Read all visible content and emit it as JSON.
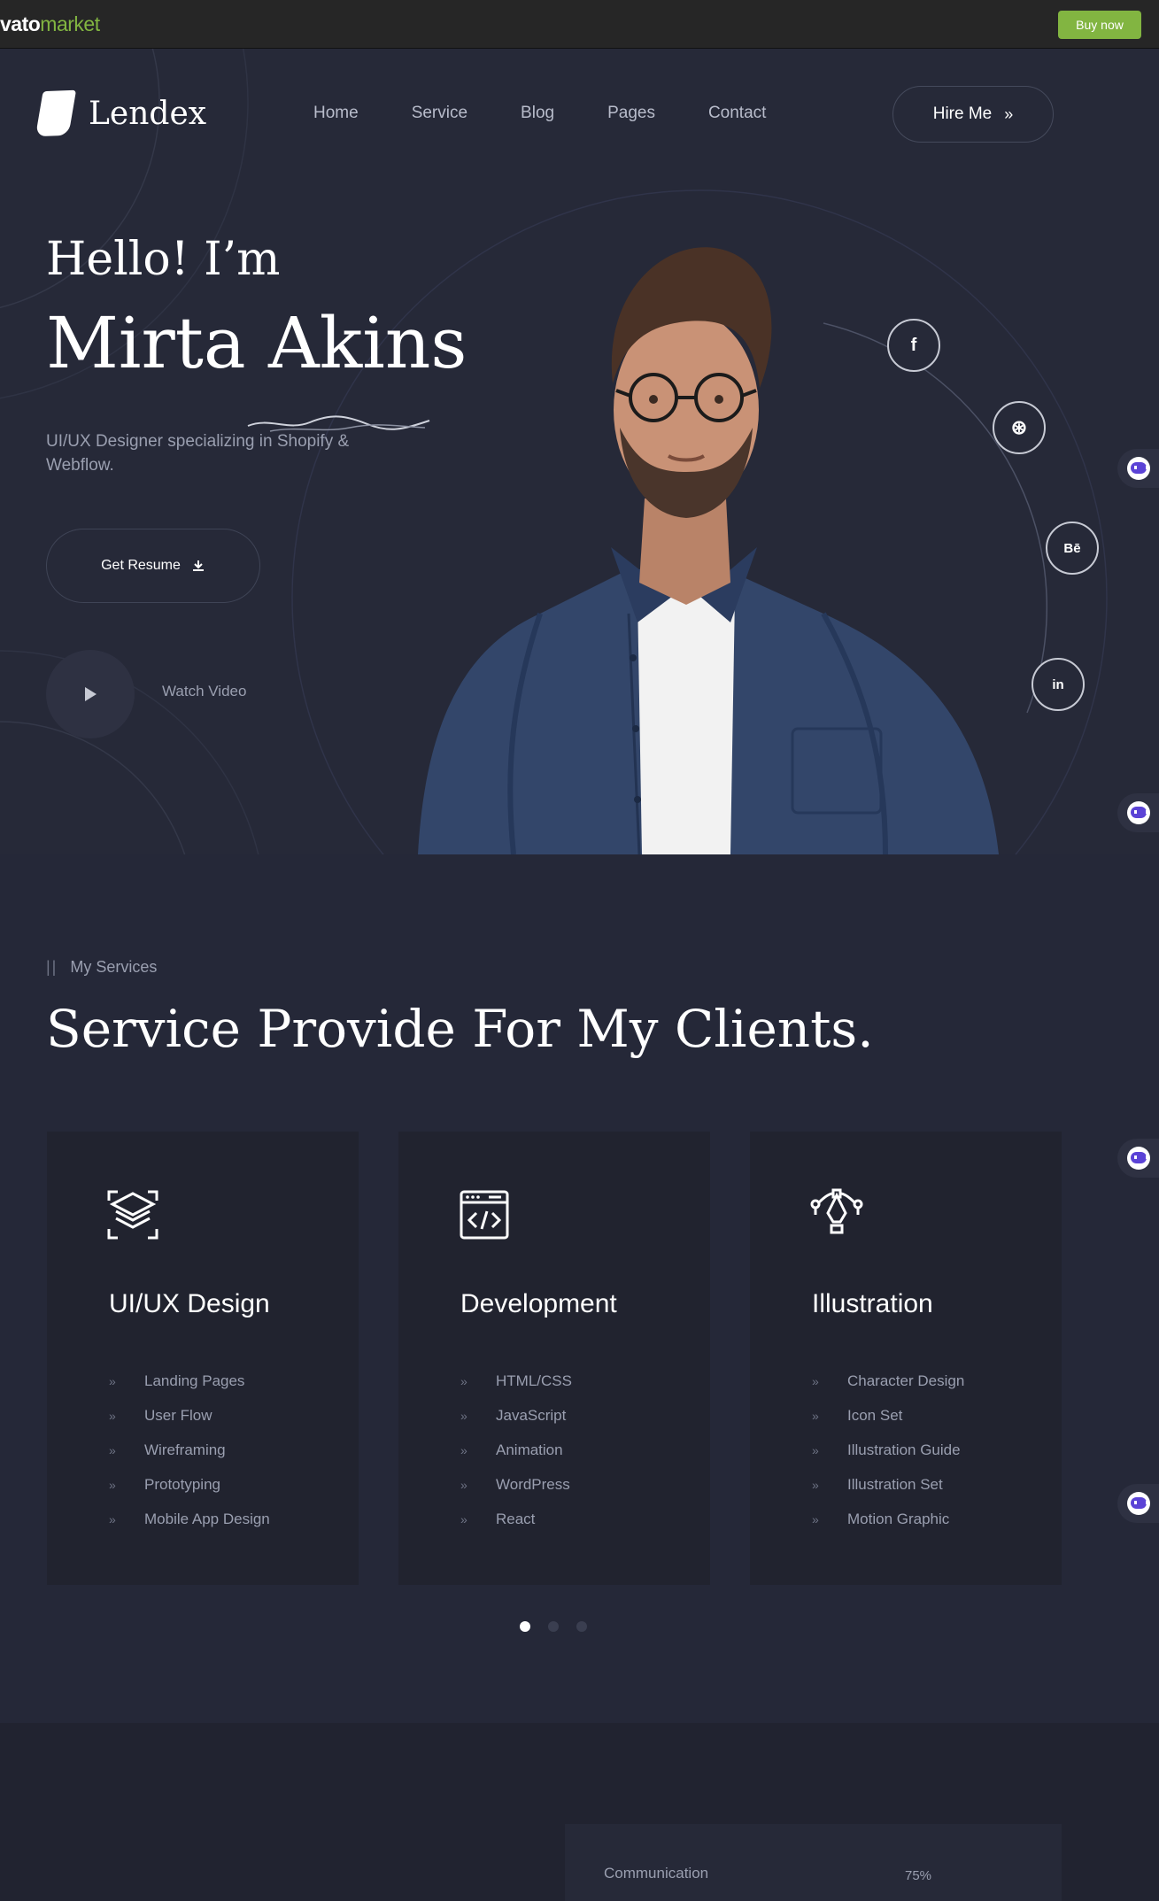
{
  "envato": {
    "logo_part1": "vato",
    "logo_part2": "market",
    "buy_label": "Buy now",
    "accent": "#82b541"
  },
  "header": {
    "brand": "Lendex",
    "nav": [
      "Home",
      "Service",
      "Blog",
      "Pages",
      "Contact"
    ],
    "hire_label": "Hire Me",
    "hire_icon": "»"
  },
  "hero": {
    "greeting": "Hello! I’m",
    "name": "Mirta Akins",
    "tagline": "UI/UX Designer specializing in Shopify & Webflow.",
    "resume_label": "Get Resume",
    "watch_label": "Watch Video",
    "social": [
      {
        "icon": "facebook-icon",
        "glyph": "f"
      },
      {
        "icon": "dribbble-icon",
        "glyph": "⊛"
      },
      {
        "icon": "behance-icon",
        "glyph": "Bē"
      },
      {
        "icon": "linkedin-icon",
        "glyph": "in"
      }
    ]
  },
  "services": {
    "eyebrow": "My Services",
    "title": "Service Provide For My Clients.",
    "cards": [
      {
        "title": "UI/UX Design",
        "icon": "layers-icon",
        "items": [
          "Landing Pages",
          "User Flow",
          "Wireframing",
          "Prototyping",
          "Mobile App Design"
        ]
      },
      {
        "title": "Development",
        "icon": "code-window-icon",
        "items": [
          "HTML/CSS",
          "JavaScript",
          "Animation",
          "WordPress",
          "React"
        ]
      },
      {
        "title": "Illustration",
        "icon": "pen-tool-icon",
        "items": [
          "Character Design",
          "Icon Set",
          "Illustration Guide",
          "Illustration Set",
          "Motion Graphic"
        ]
      }
    ],
    "pagination": {
      "count": 3,
      "active": 1
    }
  },
  "skills": {
    "items": [
      {
        "label": "Communication",
        "value": "75%"
      }
    ]
  },
  "colors": {
    "background": "#252838",
    "card": "#21232f",
    "muted_text": "#9a9fb0"
  }
}
